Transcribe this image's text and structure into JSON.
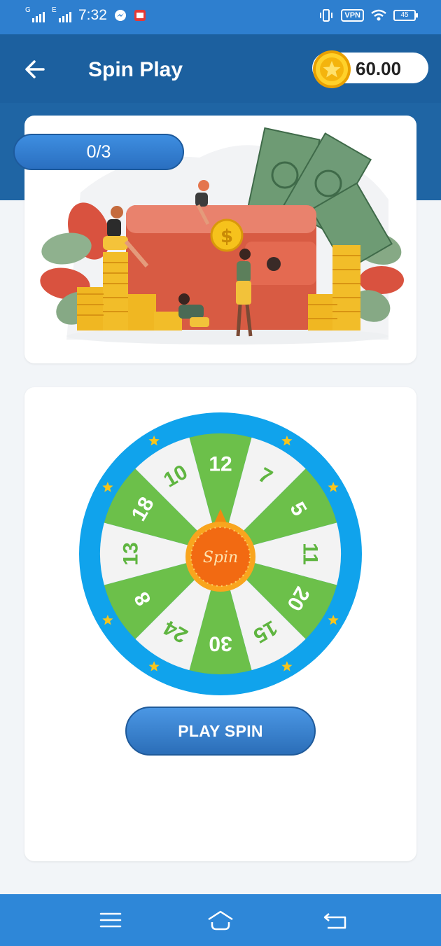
{
  "status_bar": {
    "net1": "G",
    "net2": "E",
    "time": "7:32",
    "vpn": "VPN",
    "battery": "45"
  },
  "header": {
    "title": "Spin Play",
    "balance": "60.00"
  },
  "banner": {
    "spins_used": "0/3"
  },
  "wheel": {
    "center_label": "Spin",
    "segments": [
      "12",
      "7",
      "5",
      "11",
      "20",
      "15",
      "30",
      "24",
      "8",
      "13",
      "18",
      "10"
    ],
    "colors": {
      "ring": "#10a3ec",
      "green": "#6cc04a",
      "white": "#f3f3f3",
      "hub": "#f26a12",
      "star": "#f7c51c"
    }
  },
  "actions": {
    "play_label": "PLAY SPIN"
  },
  "colors": {
    "status_bar": "#2e7fcf",
    "header": "#1f65a4",
    "nav_bar": "#2e87d8"
  },
  "icons": {
    "back": "arrow-left-icon",
    "coin": "coin-star-icon",
    "menu": "menu-icon",
    "home": "home-icon",
    "return": "return-icon"
  }
}
